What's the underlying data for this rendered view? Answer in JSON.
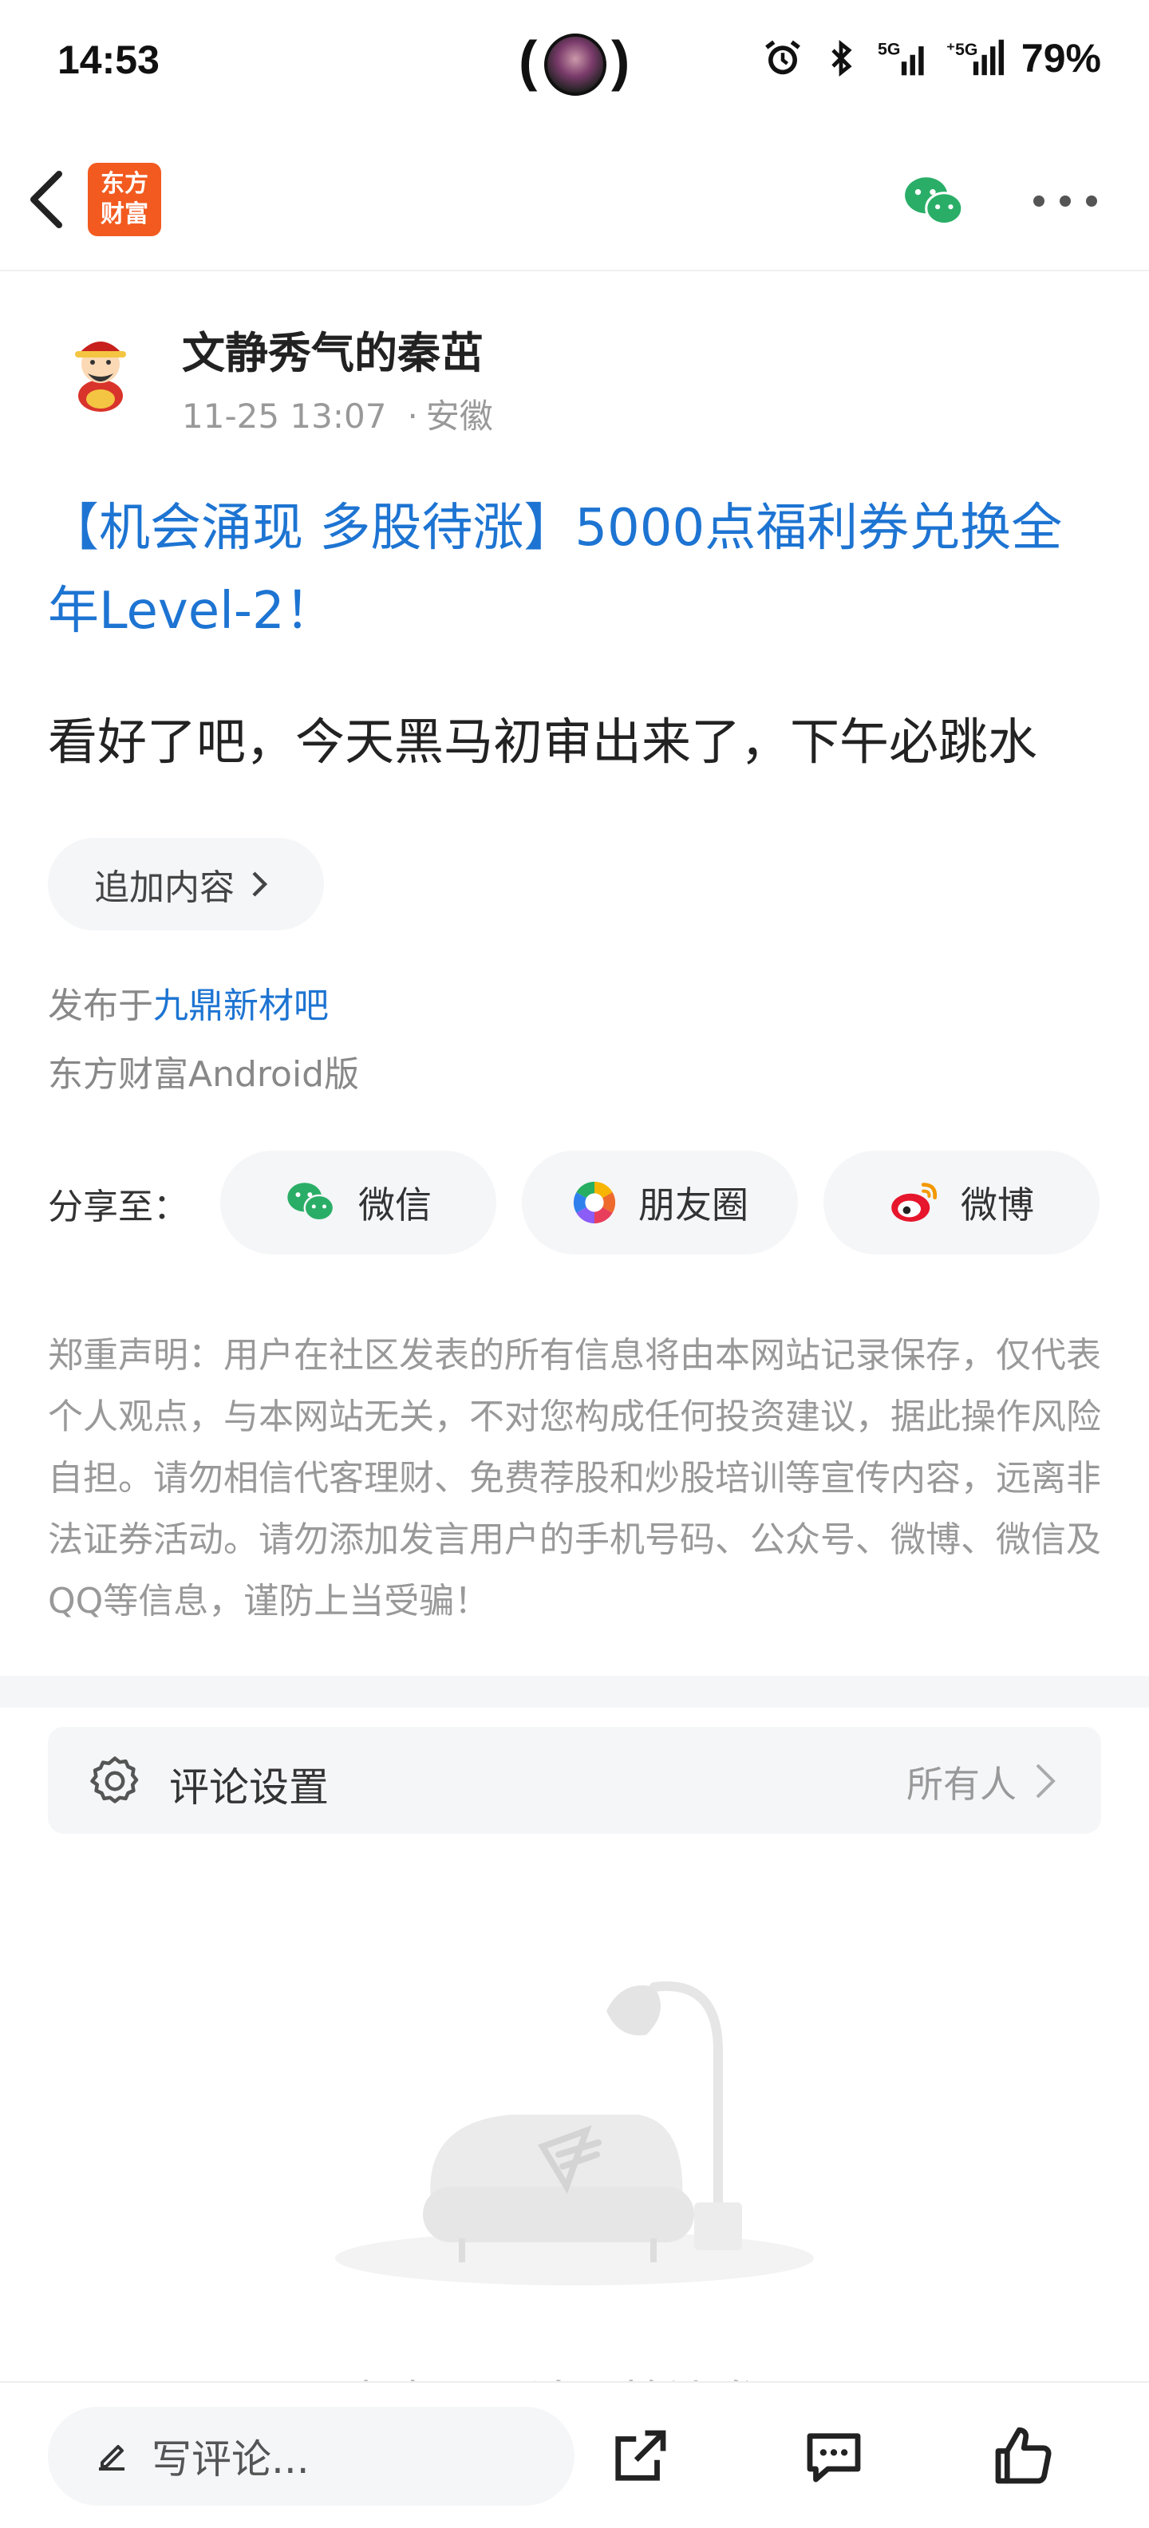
{
  "status_bar": {
    "time": "14:53",
    "battery": "79%",
    "icons": [
      "alarm-icon",
      "bluetooth-icon",
      "signal-5g-icon",
      "signal-5g-icon"
    ]
  },
  "nav": {
    "logo_line1": "东方",
    "logo_line2": "财富",
    "logo_color": "#f25a1f",
    "icons": [
      "back-icon",
      "wechat-icon",
      "more-icon"
    ]
  },
  "author": {
    "name": "文静秀气的秦茁",
    "time": "11-25 13:07",
    "location": "安徽"
  },
  "post": {
    "title": "【机会涌现 多股待涨】5000点福利券兑换全年Level-2！",
    "body": "看好了吧，今天黑马初审出来了，下午必跳水",
    "add_content_label": "追加内容",
    "published_prefix": "发布于",
    "forum": "九鼎新材吧",
    "client": "东方财富Android版"
  },
  "share": {
    "label": "分享至：",
    "options": [
      {
        "label": "微信",
        "icon": "wechat-icon"
      },
      {
        "label": "朋友圈",
        "icon": "moments-icon"
      },
      {
        "label": "微博",
        "icon": "weibo-icon"
      }
    ]
  },
  "disclaimer": "郑重声明：用户在社区发表的所有信息将由本网站记录保存，仅代表个人观点，与本网站无关，不对您构成任何投资建议，据此操作风险自担。请勿相信代客理财、免费荐股和炒股培训等宣传内容，远离非法证券活动。请勿添加发言用户的手机号码、公众号、微博、微信及QQ等信息，谨防上当受骗！",
  "comment_settings": {
    "label": "评论设置",
    "value": "所有人"
  },
  "empty_state": {
    "text": "点击回评论，抢沙发！"
  },
  "bottom_bar": {
    "comment_placeholder": "写评论...",
    "icons": [
      "pencil-icon",
      "share-icon",
      "comments-icon",
      "like-icon"
    ]
  },
  "colors": {
    "link_blue": "#1d74d2",
    "wechat_green": "#2aae67",
    "weibo_red": "#e6162d"
  }
}
